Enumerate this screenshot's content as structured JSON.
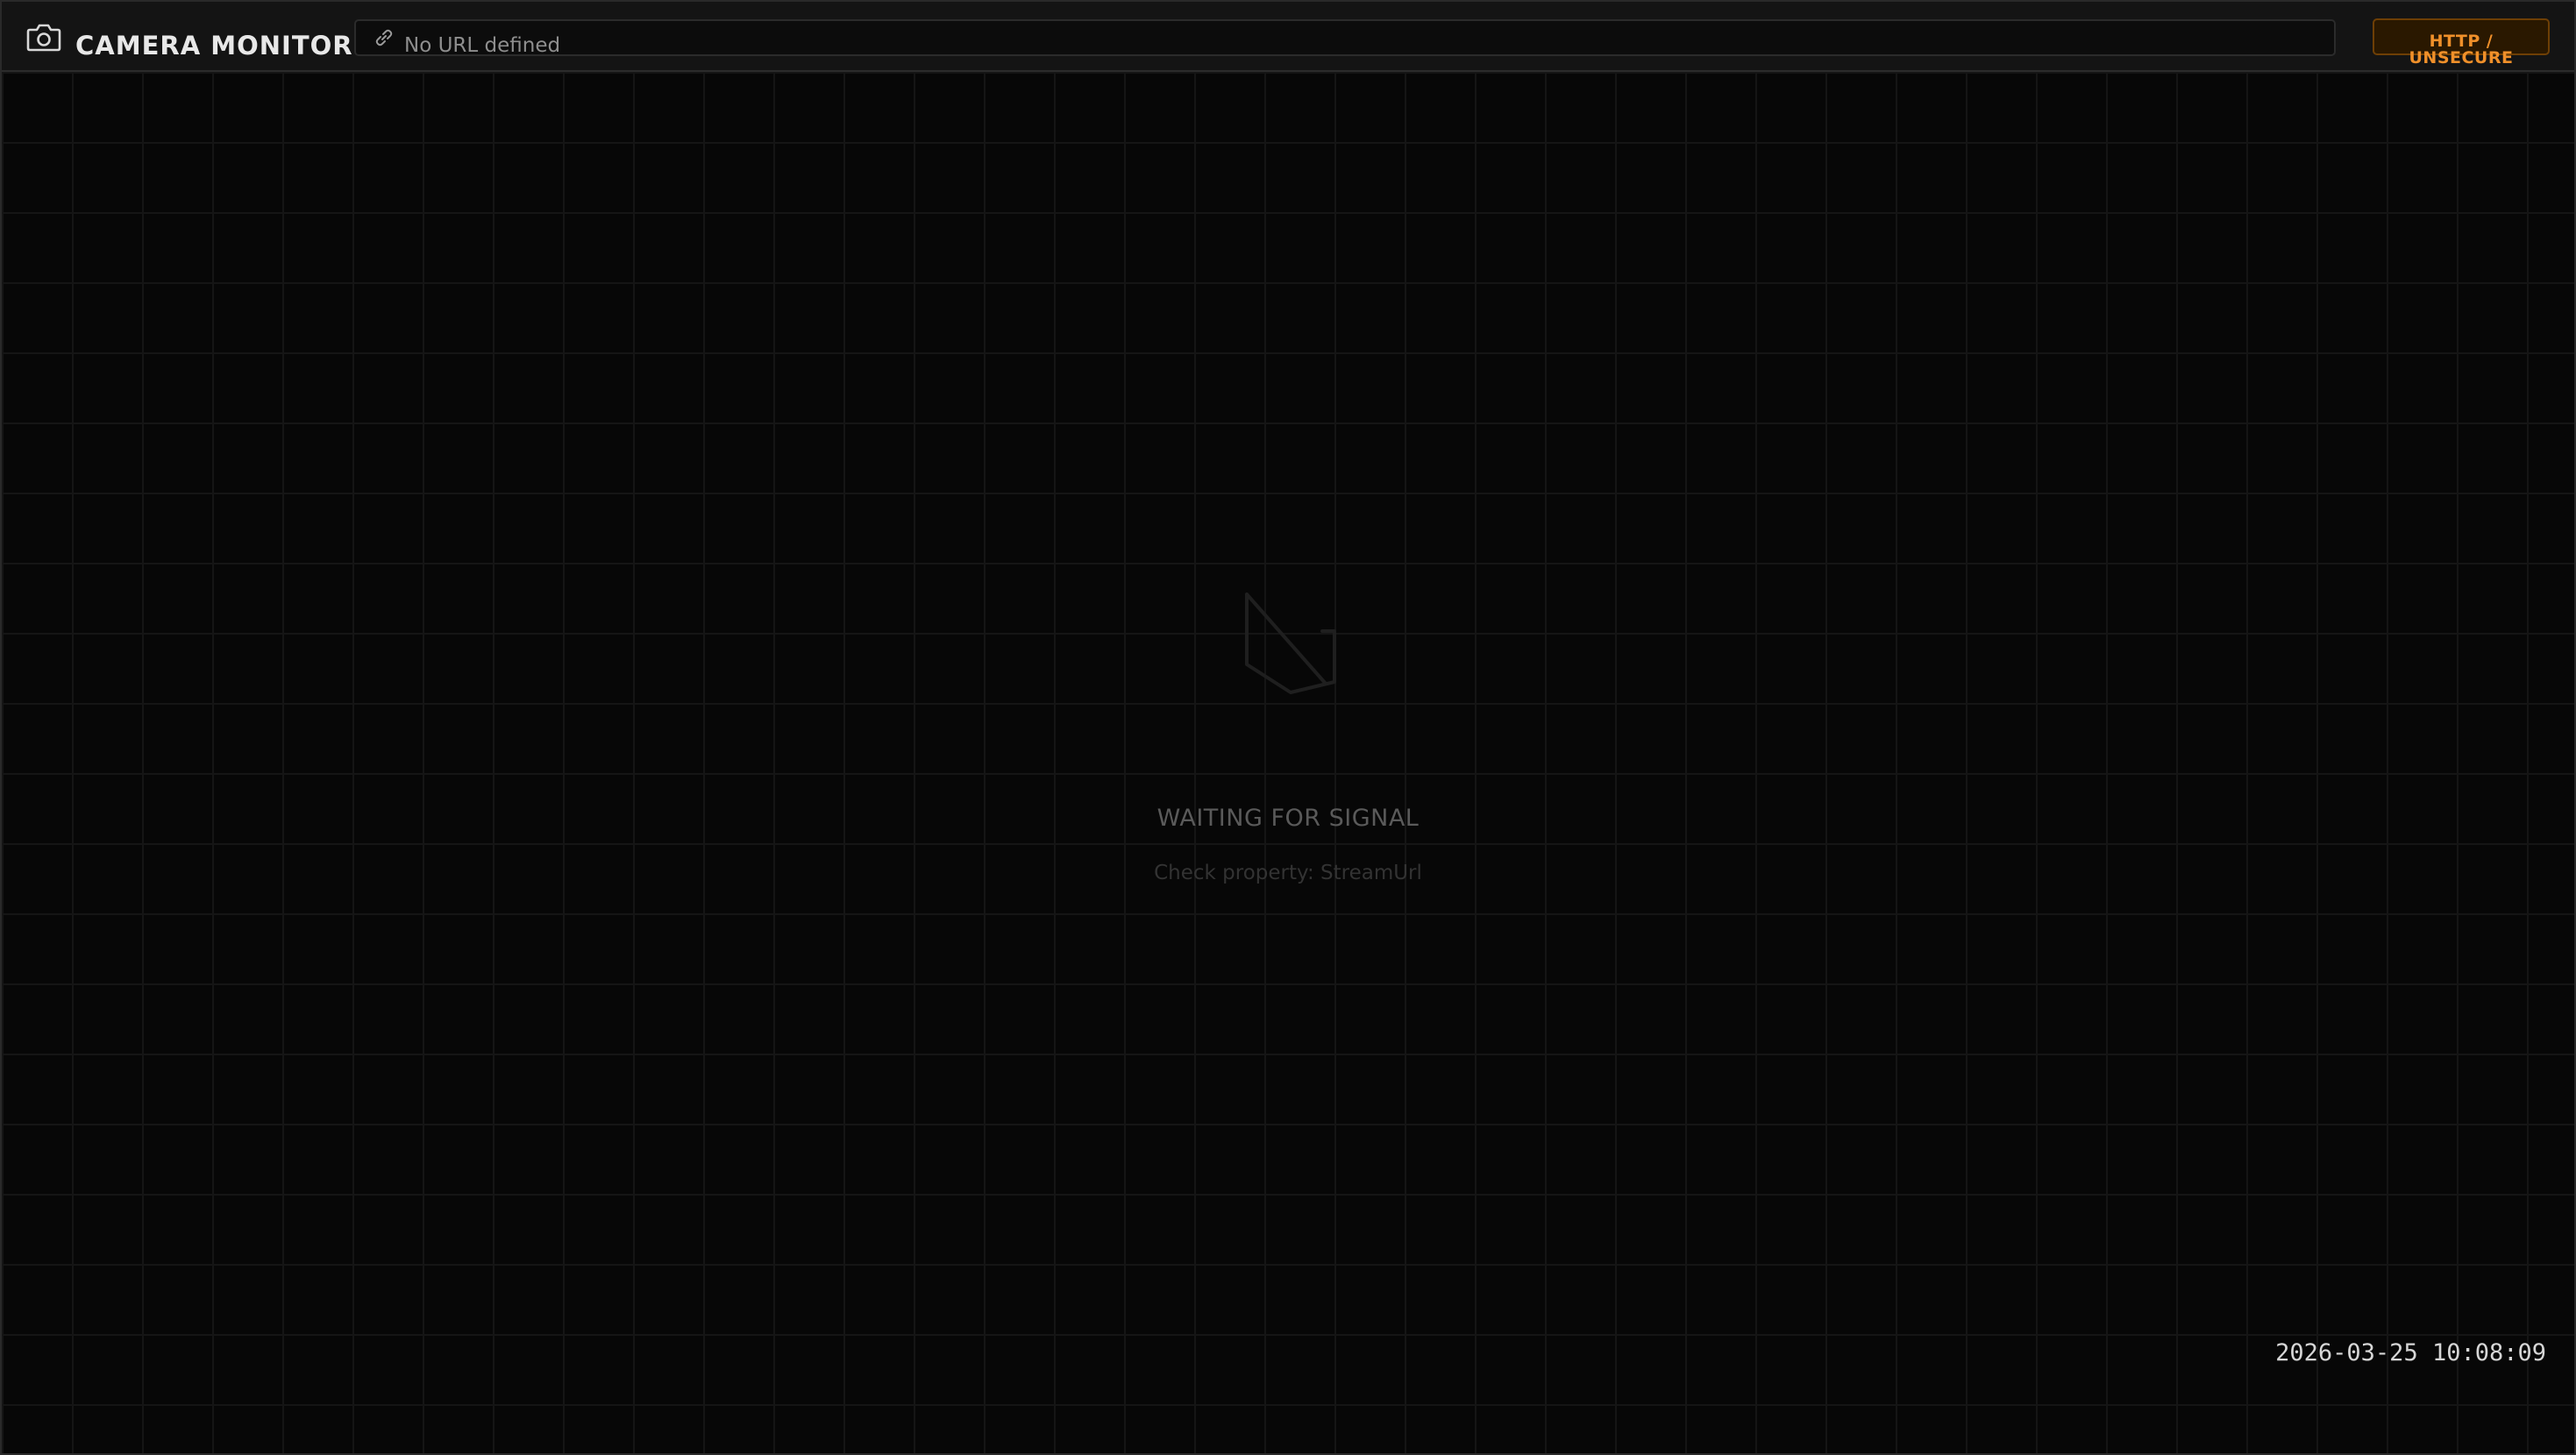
{
  "header": {
    "title": "CAMERA MONITOR",
    "camera_icon": "camera-icon"
  },
  "url_bar": {
    "link_icon": "link-icon",
    "text": "No URL defined"
  },
  "security_badge": {
    "label": "HTTP / UNSECURE",
    "color": "#f0902a"
  },
  "viewport": {
    "status_icon": "no-signal-icon",
    "status_text": "WAITING FOR SIGNAL",
    "hint_text": "Check property: StreamUrl"
  },
  "footer": {
    "timestamp": "2026-03-25 10:08:09"
  }
}
